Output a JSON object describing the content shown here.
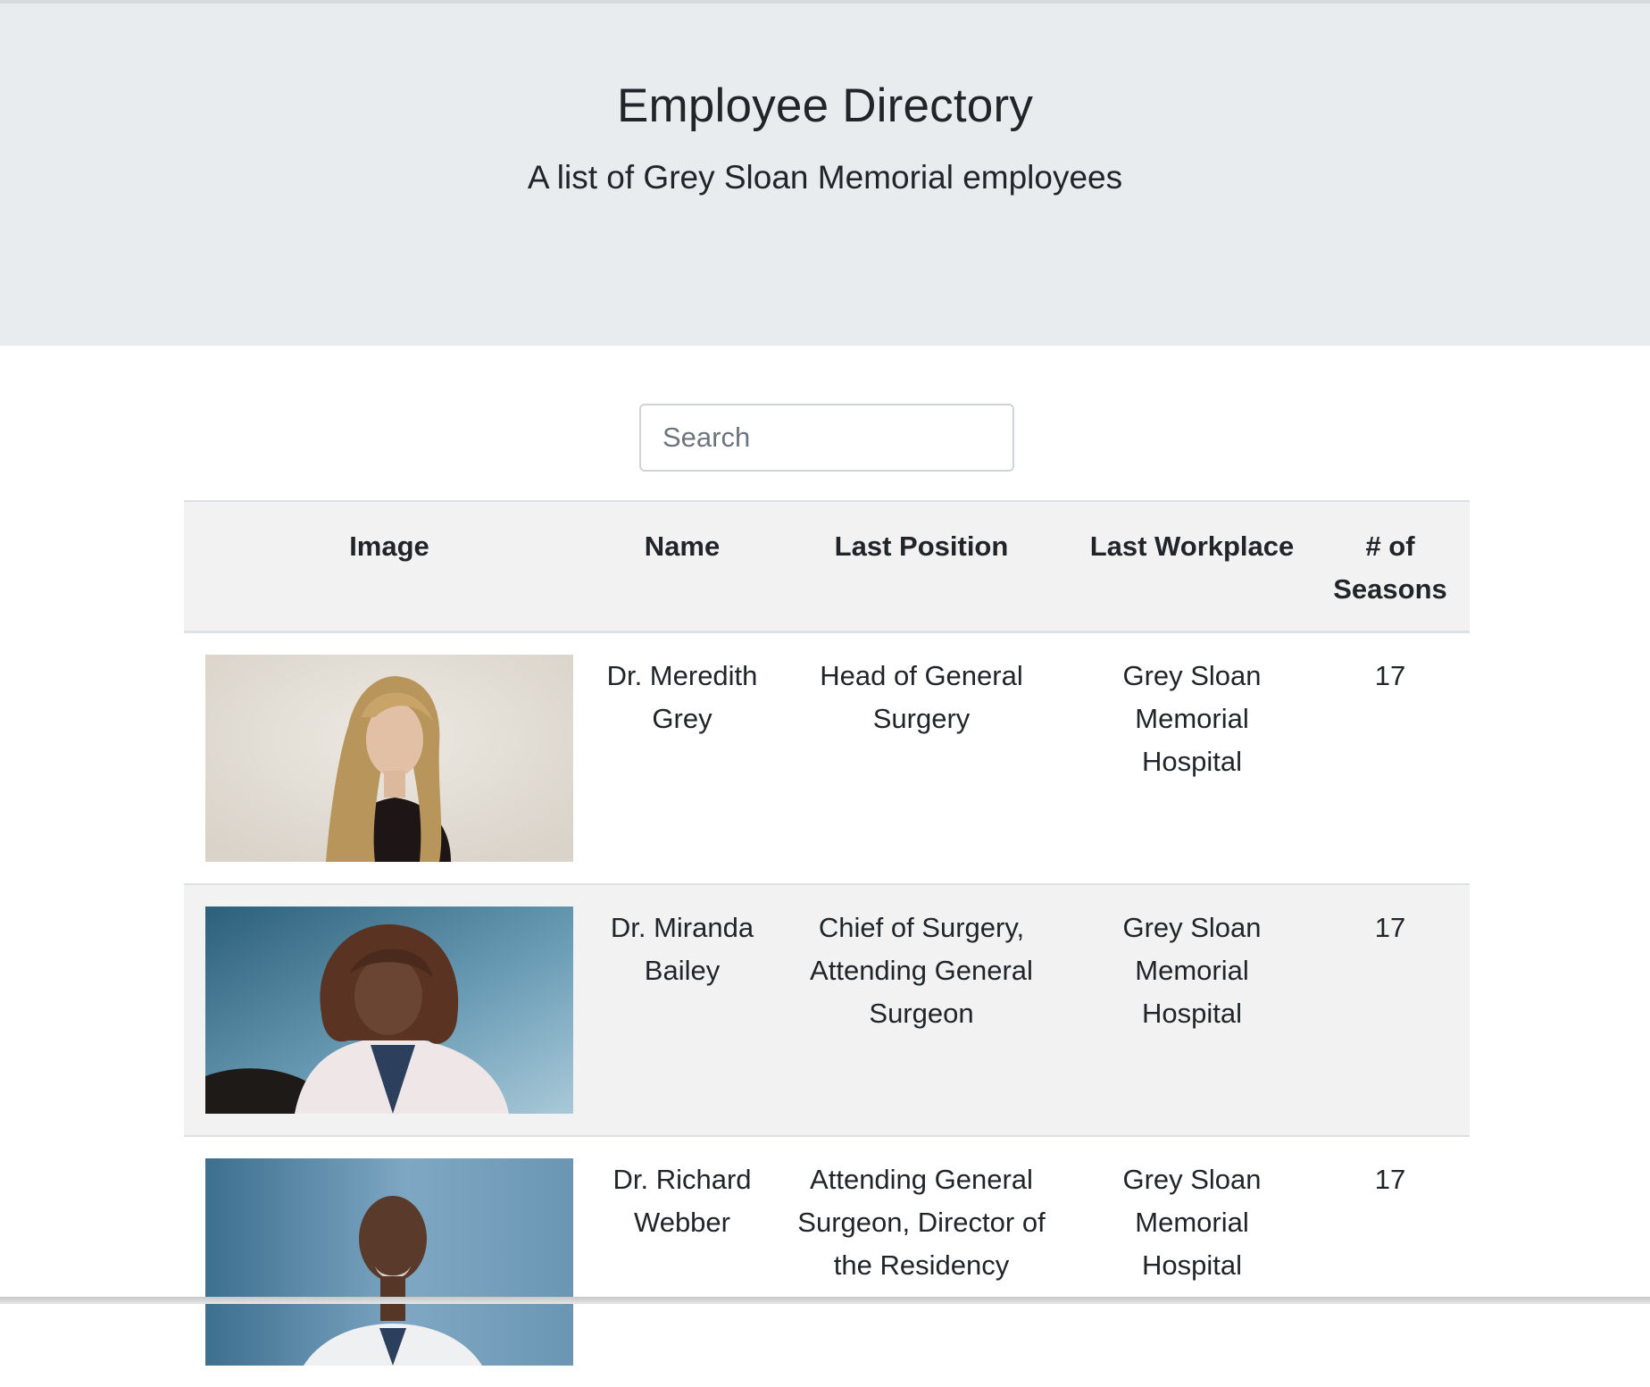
{
  "header": {
    "title": "Employee Directory",
    "subtitle": "A list of Grey Sloan Memorial employees"
  },
  "search": {
    "placeholder": "Search",
    "value": ""
  },
  "table": {
    "columns": [
      "Image",
      "Name",
      "Last Position",
      "Last Workplace",
      "# of Seasons"
    ],
    "rows": [
      {
        "name": "Dr. Meredith Grey",
        "position": "Head of General Surgery",
        "workplace": "Grey Sloan Memorial Hospital",
        "seasons": "17"
      },
      {
        "name": "Dr. Miranda Bailey",
        "position": "Chief of Surgery, Attending General Surgeon",
        "workplace": "Grey Sloan Memorial Hospital",
        "seasons": "17"
      },
      {
        "name": "Dr. Richard Webber",
        "position": "Attending General Surgeon, Director of the Residency",
        "workplace": "Grey Sloan Memorial Hospital",
        "seasons": "17"
      }
    ]
  },
  "colors": {
    "jumbotron_bg": "#e9ecef",
    "stripe_bg": "#f2f2f2",
    "border": "#dee2e6",
    "text": "#212529"
  }
}
